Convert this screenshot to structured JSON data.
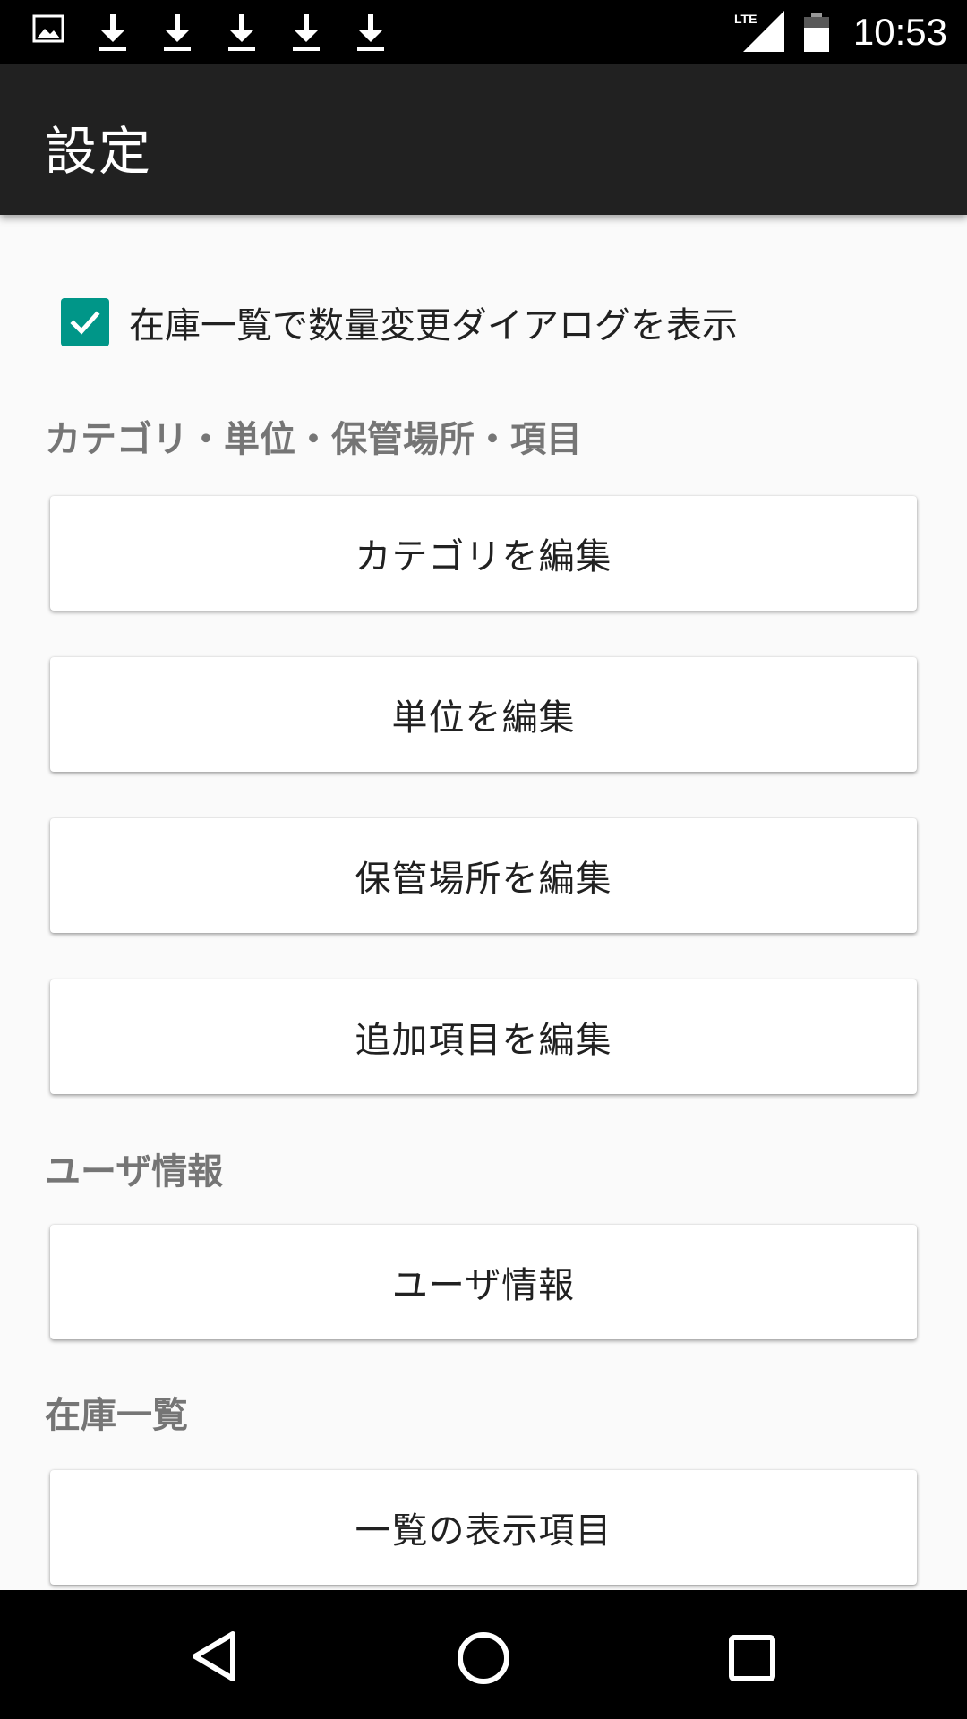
{
  "status_bar": {
    "time": "10:53",
    "network": "LTE",
    "icons": [
      "gallery-icon",
      "download-icon",
      "download-icon",
      "download-icon",
      "download-icon",
      "download-icon",
      "signal-icon",
      "battery-icon"
    ]
  },
  "toolbar": {
    "title": "設定"
  },
  "settings": {
    "show_quantity_dialog": {
      "label": "在庫一覧で数量変更ダイアログを表示",
      "checked": true,
      "accent": "#009688"
    },
    "sections": [
      {
        "header": "カテゴリ・単位・保管場所・項目",
        "buttons": [
          "カテゴリを編集",
          "単位を編集",
          "保管場所を編集",
          "追加項目を編集"
        ]
      },
      {
        "header": "ユーザ情報",
        "buttons": [
          "ユーザ情報"
        ]
      },
      {
        "header": "在庫一覧",
        "buttons": [
          "一覧の表示項目"
        ]
      }
    ]
  },
  "nav_bar": {
    "icons": [
      "back-icon",
      "home-icon",
      "recents-icon"
    ]
  },
  "colors": {
    "toolbar": "#212121",
    "status_bar": "#000000",
    "background": "#fafafa",
    "section_header": "#757575"
  }
}
